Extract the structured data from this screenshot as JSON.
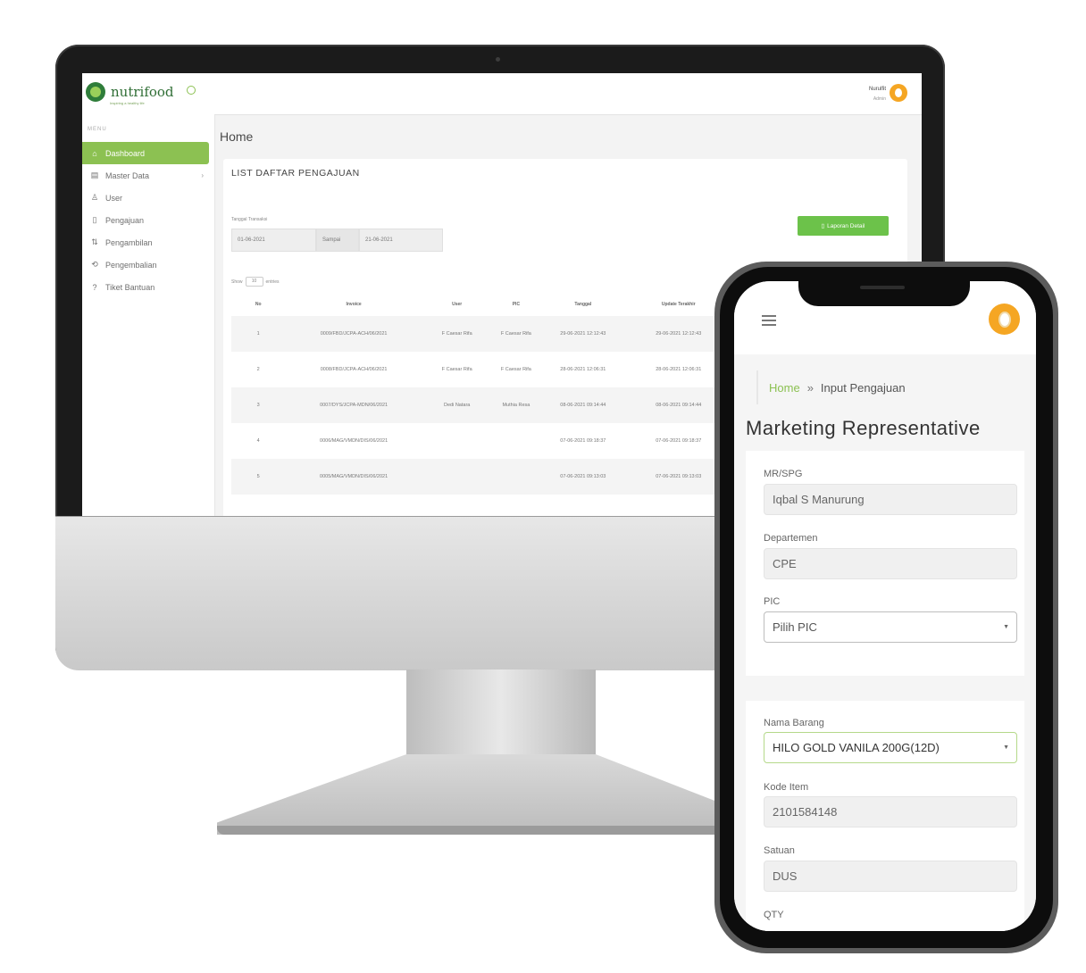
{
  "desktop": {
    "brand": {
      "name": "nutrifood",
      "tagline": "Inspiring a healthy life"
    },
    "menu_title": "MENU",
    "menu": [
      {
        "label": "Dashboard",
        "icon": "home-icon",
        "glyph": "⌂"
      },
      {
        "label": "Master Data",
        "icon": "table-icon",
        "glyph": "▤",
        "caret": "›"
      },
      {
        "label": "User",
        "icon": "user-icon",
        "glyph": "♙"
      },
      {
        "label": "Pengajuan",
        "icon": "document-icon",
        "glyph": "▯"
      },
      {
        "label": "Pengambilan",
        "icon": "transfer-icon",
        "glyph": "⇅"
      },
      {
        "label": "Pengembalian",
        "icon": "return-icon",
        "glyph": "⟲"
      },
      {
        "label": "Tiket Bantuan",
        "icon": "help-icon",
        "glyph": "?"
      }
    ],
    "user": {
      "name": "Nurulfit",
      "role": "Admin"
    },
    "page_title": "Home",
    "card_title": "LIST DAFTAR PENGAJUAN",
    "filter": {
      "label": "Tanggal Transaksi",
      "from": "01-06-2021",
      "separator": "Sampai",
      "to": "21-06-2021"
    },
    "report_button": "Laporan Detail",
    "show_entries": {
      "prefix": "Show",
      "value": "10",
      "suffix": "entries"
    },
    "table": {
      "headers": [
        "No",
        "Invoice",
        "User",
        "PIC",
        "Tanggal",
        "Update Terakhir"
      ],
      "rows": [
        [
          "1",
          "0009/FBD/JCPA-ACH/06/2021",
          "F Caesar Rifa",
          "F Caesar Rifa",
          "29-06-2021 12:12:43",
          "29-06-2021 12:12:43"
        ],
        [
          "2",
          "0008/FBD/JCPA-ACH/06/2021",
          "F Caesar Rifa",
          "F Caesar Rifa",
          "28-06-2021 12:06:31",
          "28-06-2021 12:06:31"
        ],
        [
          "3",
          "0007/DYS/JCPA-MDN/06/2021",
          "Dedi Natara",
          "Muthia Resa",
          "08-06-2021 09:14:44",
          "08-06-2021 09:14:44"
        ],
        [
          "4",
          "0006/MAG/VMDN/DIS/06/2021",
          "",
          "",
          "07-06-2021 09:18:37",
          "07-06-2021 09:18:37"
        ],
        [
          "5",
          "0005/MAG/VMDN/DIS/06/2021",
          "",
          "",
          "07-06-2021 09:13:03",
          "07-06-2021 09:13:03"
        ]
      ]
    }
  },
  "mobile": {
    "breadcrumb": {
      "home": "Home",
      "separator": "»",
      "current": "Input Pengajuan"
    },
    "title": "Marketing Representative",
    "fields": {
      "mr_spg": {
        "label": "MR/SPG",
        "value": "Iqbal S Manurung"
      },
      "departemen": {
        "label": "Departemen",
        "value": "CPE"
      },
      "pic": {
        "label": "PIC",
        "value": "Pilih PIC"
      },
      "nama_barang": {
        "label": "Nama Barang",
        "value": "HILO GOLD VANILA 200G(12D)"
      },
      "kode_item": {
        "label": "Kode Item",
        "value": "2101584148"
      },
      "satuan": {
        "label": "Satuan",
        "value": "DUS"
      },
      "qty": {
        "label": "QTY"
      }
    },
    "accent": "#8cc152",
    "avatar_color": "#f5a623"
  }
}
